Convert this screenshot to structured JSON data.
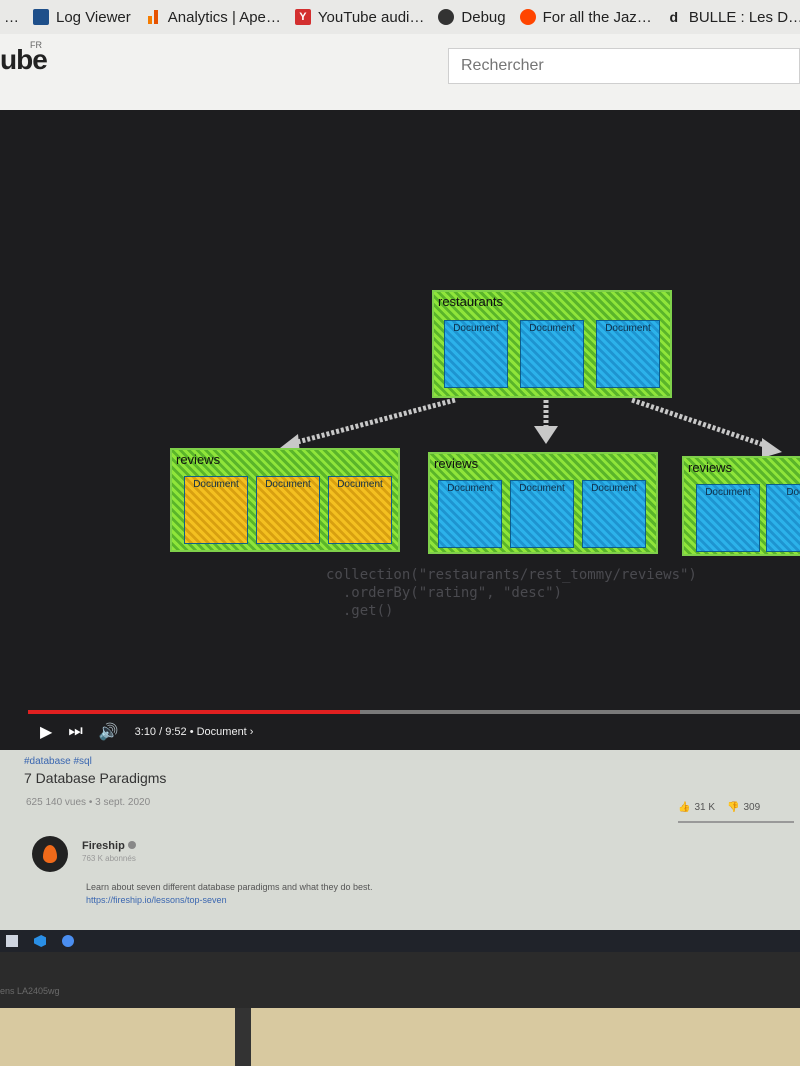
{
  "bookmarks": [
    {
      "label": "…",
      "icon": "ellipsis"
    },
    {
      "label": "Log Viewer",
      "icon": "log-viewer-icon"
    },
    {
      "label": "Analytics | Ape…",
      "icon": "analytics-icon"
    },
    {
      "label": "YouTube audi…",
      "icon": "youtube-audio-icon"
    },
    {
      "label": "Debug",
      "icon": "debug-icon"
    },
    {
      "label": "For all the Jaz…",
      "icon": "reddit-icon"
    },
    {
      "label": "BULLE : Les D…",
      "icon": "d-icon"
    }
  ],
  "header": {
    "logo_text": "ube",
    "region": "FR",
    "search_placeholder": "Rechercher"
  },
  "video": {
    "diagram": {
      "root": {
        "label": "restaurants",
        "documents": [
          "Document",
          "Document",
          "Document"
        ]
      },
      "children": [
        {
          "label": "reviews",
          "documents": [
            "Document",
            "Document",
            "Document"
          ],
          "color": "#f4c020"
        },
        {
          "label": "reviews",
          "documents": [
            "Document",
            "Document",
            "Document"
          ],
          "color": "#2cb2ea"
        },
        {
          "label": "reviews",
          "documents": [
            "Document",
            "Docu"
          ],
          "color": "#2cb2ea"
        }
      ]
    },
    "code_lines": [
      "collection(\"restaurants/rest_tommy/reviews\")",
      "  .orderBy(\"rating\", \"desc\")",
      "  .get()"
    ],
    "current_time": "3:10",
    "duration": "9:52",
    "chapter": "Document",
    "time_display": "3:10 / 9:52",
    "progress": 0.43
  },
  "info": {
    "hashtag": "#database #sql",
    "title": "7 Database Paradigms",
    "views": "625 140 vues • 3 sept. 2020",
    "likes": "31 K",
    "dislikes": "309",
    "channel": "Fireship",
    "subscribers": "763 K abonnés",
    "description": "Learn about seven different database paradigms and what they do best.",
    "link": "https://fireship.io/lessons/top-seven"
  },
  "monitor_label": "ens LA2405wg",
  "colors": {
    "accent_green": "#8fe53a",
    "doc_blue": "#2cb2ea",
    "doc_yellow": "#f4c020",
    "progress_red": "#e02020"
  }
}
